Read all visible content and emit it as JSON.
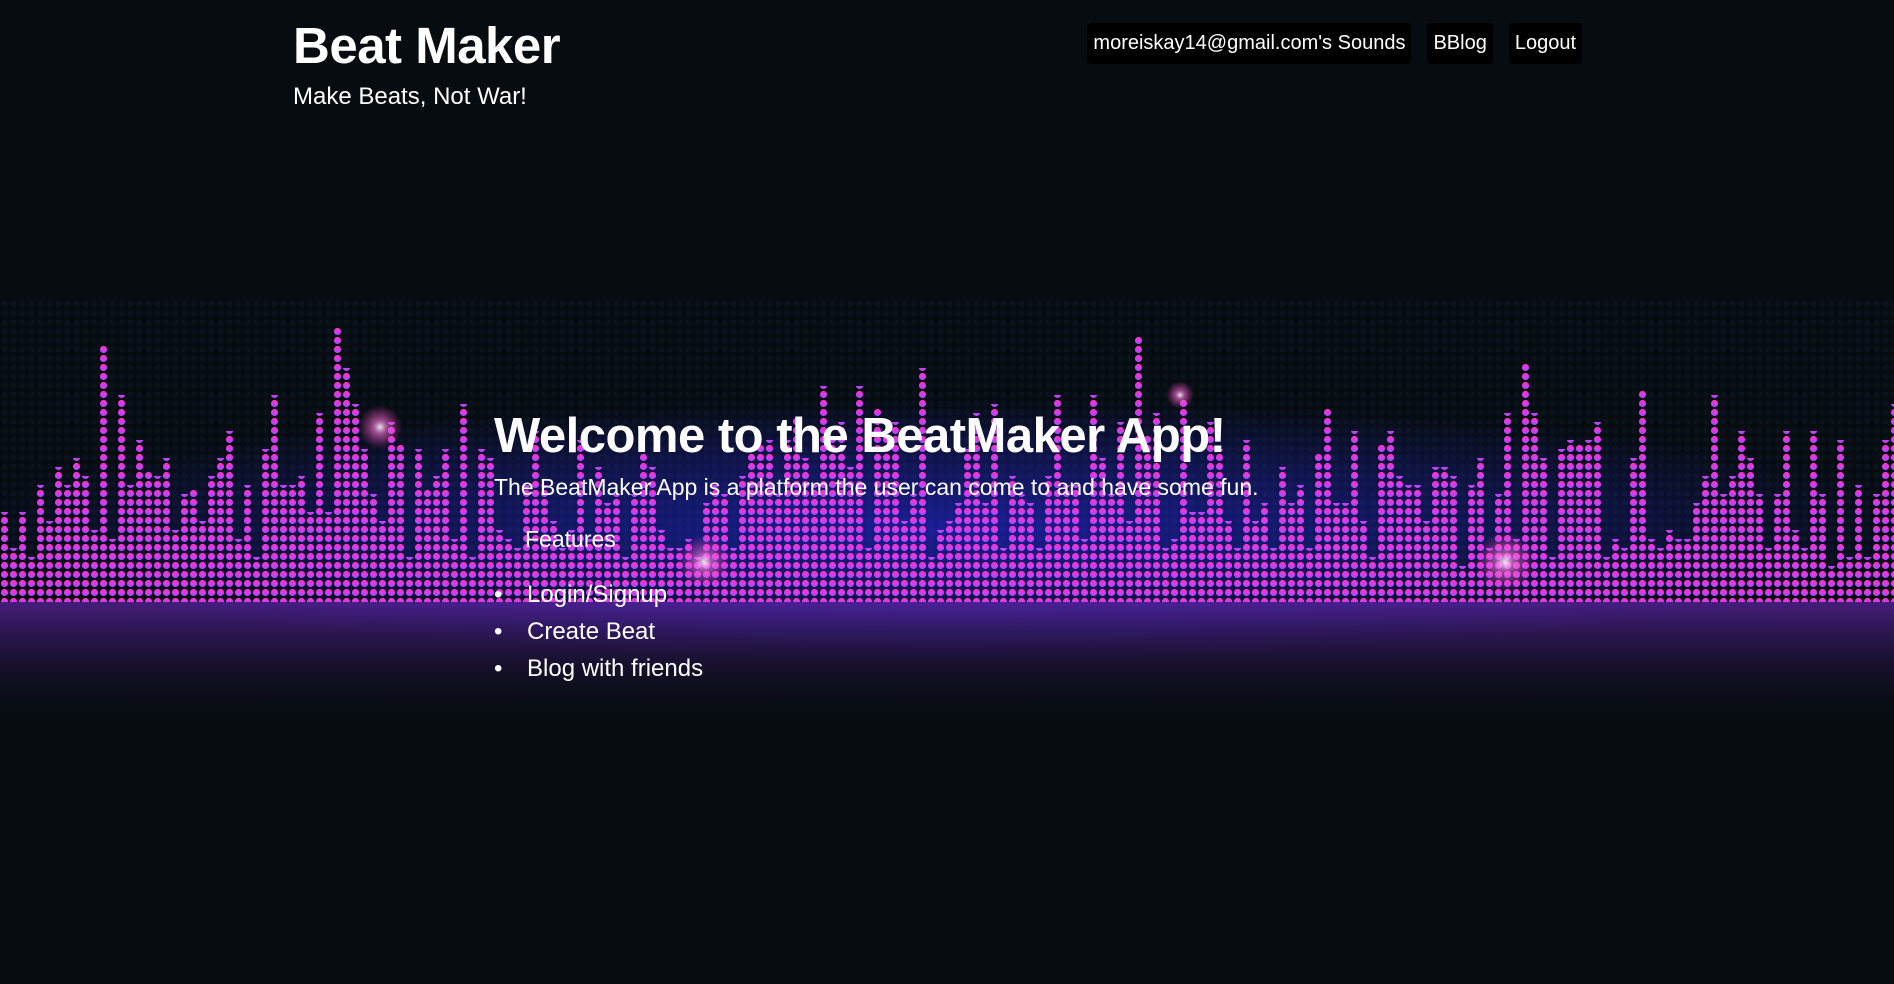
{
  "header": {
    "title": "Beat Maker",
    "tagline": "Make Beats, Not War!"
  },
  "nav": {
    "items": [
      {
        "label": "moreiskay14@gmail.com's Sounds"
      },
      {
        "label": "BBlog"
      },
      {
        "label": "Logout"
      }
    ]
  },
  "hero": {
    "title": "Welcome to the BeatMaker App!",
    "description": "The BeatMaker App is a platform the user can come to and have some fun.",
    "features_heading": "Features",
    "features": [
      "Login/Signup",
      "Create Beat",
      "Blog with friends"
    ],
    "bullet": "•"
  },
  "theme": {
    "background": "#060c10",
    "viz_pink": "#ff2fb9",
    "viz_purple": "#b53cff",
    "viz_blue": "#2a2cff"
  }
}
